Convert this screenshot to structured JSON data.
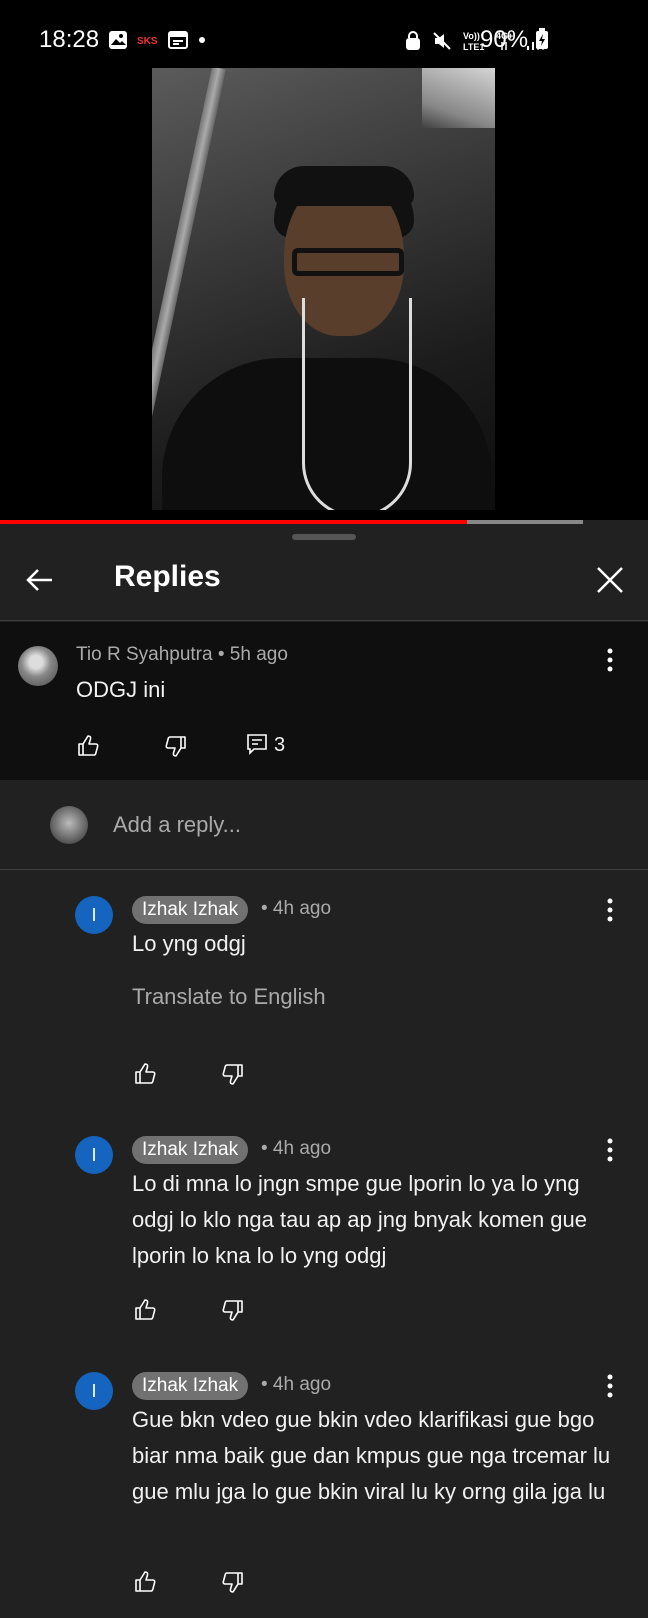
{
  "status_bar": {
    "time": "18:28",
    "battery": "90%",
    "network_top": "4G+",
    "volte": "Vo)) LTE1"
  },
  "header": {
    "title": "Replies"
  },
  "parent_comment": {
    "author": "Tio R Syahputra",
    "time": "• 5h ago",
    "text": "ODGJ ini",
    "reply_count": "3"
  },
  "add_reply": {
    "placeholder": "Add a reply..."
  },
  "replies": [
    {
      "avatar_letter": "I",
      "author": "Izhak Izhak",
      "time": "• 4h ago",
      "text": "Lo yng odgj",
      "translate": "Translate to English"
    },
    {
      "avatar_letter": "I",
      "author": "Izhak Izhak",
      "time": "• 4h ago",
      "text": "Lo di mna lo jngn smpe gue lporin lo ya lo yng odgj lo klo nga tau ap ap jng bnyak komen gue lporin lo kna lo  lo yng odgj"
    },
    {
      "avatar_letter": "I",
      "author": "Izhak Izhak",
      "time": "• 4h ago",
      "text": "Gue bkn vdeo gue bkin vdeo klarifikasi gue bgo biar nma baik gue dan kmpus gue nga trcemar lu gue mlu jga lo gue bkin viral lu ky orng gila jga lu"
    }
  ],
  "video": {
    "progress": 0.72,
    "buffered": 0.9
  }
}
